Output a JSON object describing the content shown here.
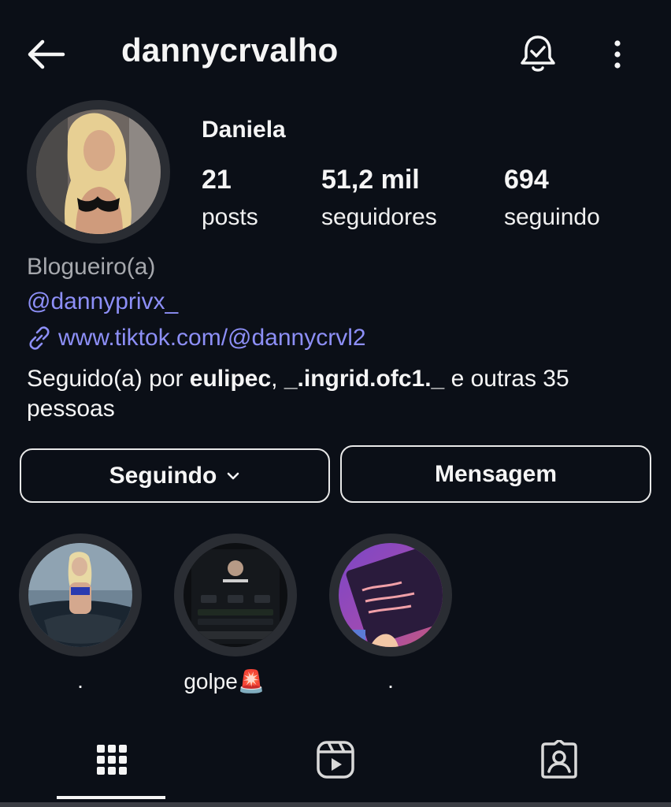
{
  "topbar": {
    "back_icon": "arrow-left-icon",
    "username": "dannycrvalho",
    "notify_icon": "bell-check-icon",
    "more_icon": "more-vertical-icon"
  },
  "profile": {
    "name": "Daniela",
    "stats": [
      {
        "value": "21",
        "label": "posts"
      },
      {
        "value": "51,2 mil",
        "label": "seguidores"
      },
      {
        "value": "694",
        "label": "seguindo"
      }
    ],
    "category": "Blogueiro(a)",
    "handle_link": "@dannyprivx_",
    "website": "www.tiktok.com/@dannycrvl2",
    "followed_prefix": "Seguido(a) por ",
    "followed_user1": "eulipec",
    "followed_sep": ", ",
    "followed_user2": "_.ingrid.ofc1._",
    "followed_suffix": " e outras 35 pessoas"
  },
  "buttons": {
    "following_label": "Seguindo",
    "message_label": "Mensagem"
  },
  "highlights": [
    {
      "label": "."
    },
    {
      "label": "golpe🚨"
    },
    {
      "label": "."
    }
  ],
  "tabs": [
    "grid-icon",
    "reels-icon",
    "tagged-icon"
  ],
  "colors": {
    "background": "#0b0f17",
    "link": "#8d8ff7",
    "muted": "#a6a8ad"
  }
}
